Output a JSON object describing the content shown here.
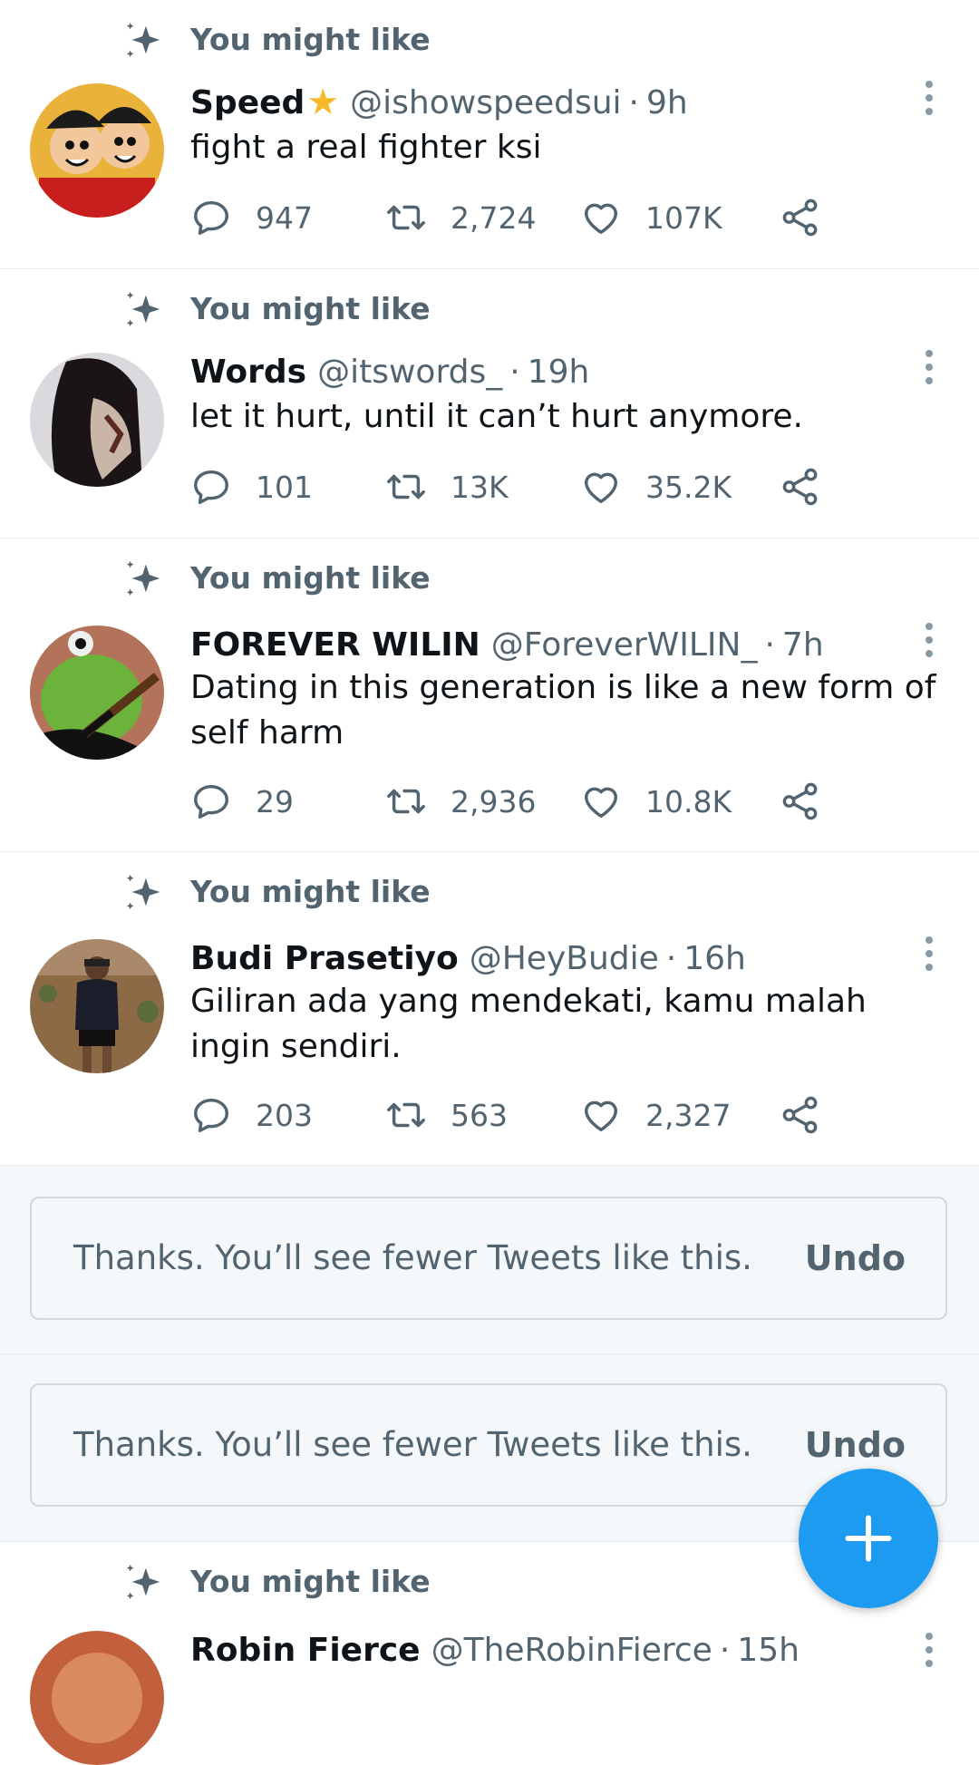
{
  "context_label": "You might like",
  "tweets": [
    {
      "name": "Speed",
      "verified_star": "★",
      "handle": "@ishowspeedsui",
      "time": "9h",
      "text": "fight a real fighter ksi",
      "replies": "947",
      "retweets": "2,724",
      "likes": "107K"
    },
    {
      "name": "Words",
      "handle": "@itswords_",
      "time": "19h",
      "text": "let it hurt, until it can’t hurt anymore.",
      "replies": "101",
      "retweets": "13K",
      "likes": "35.2K"
    },
    {
      "name": "FOREVER WILIN",
      "handle": "@ForeverWILIN_",
      "time": "7h",
      "text": "Dating in this generation is like a new form of self harm",
      "replies": "29",
      "retweets": "2,936",
      "likes": "10.8K"
    },
    {
      "name": "Budi Prasetiyo",
      "handle": "@HeyBudie",
      "time": "16h",
      "text": "Giliran ada yang mendekati, kamu malah ingin sendiri.",
      "replies": "203",
      "retweets": "563",
      "likes": "2,327"
    },
    {
      "name": "Robin Fierce",
      "handle": "@TheRobinFierce",
      "time": "15h"
    }
  ],
  "feedback": [
    {
      "message": "Thanks. You’ll see fewer Tweets like this.",
      "undo": "Undo"
    },
    {
      "message": "Thanks. You’ll see fewer Tweets like this.",
      "undo": "Undo"
    }
  ],
  "dot_separator": "·",
  "colors": {
    "accent": "#1d9bf0",
    "muted": "#536471",
    "star": "#f7b928"
  },
  "icons": [
    "sparkle-icon",
    "reply-icon",
    "retweet-icon",
    "like-icon",
    "share-icon",
    "more-options-icon",
    "compose-plus-icon"
  ]
}
